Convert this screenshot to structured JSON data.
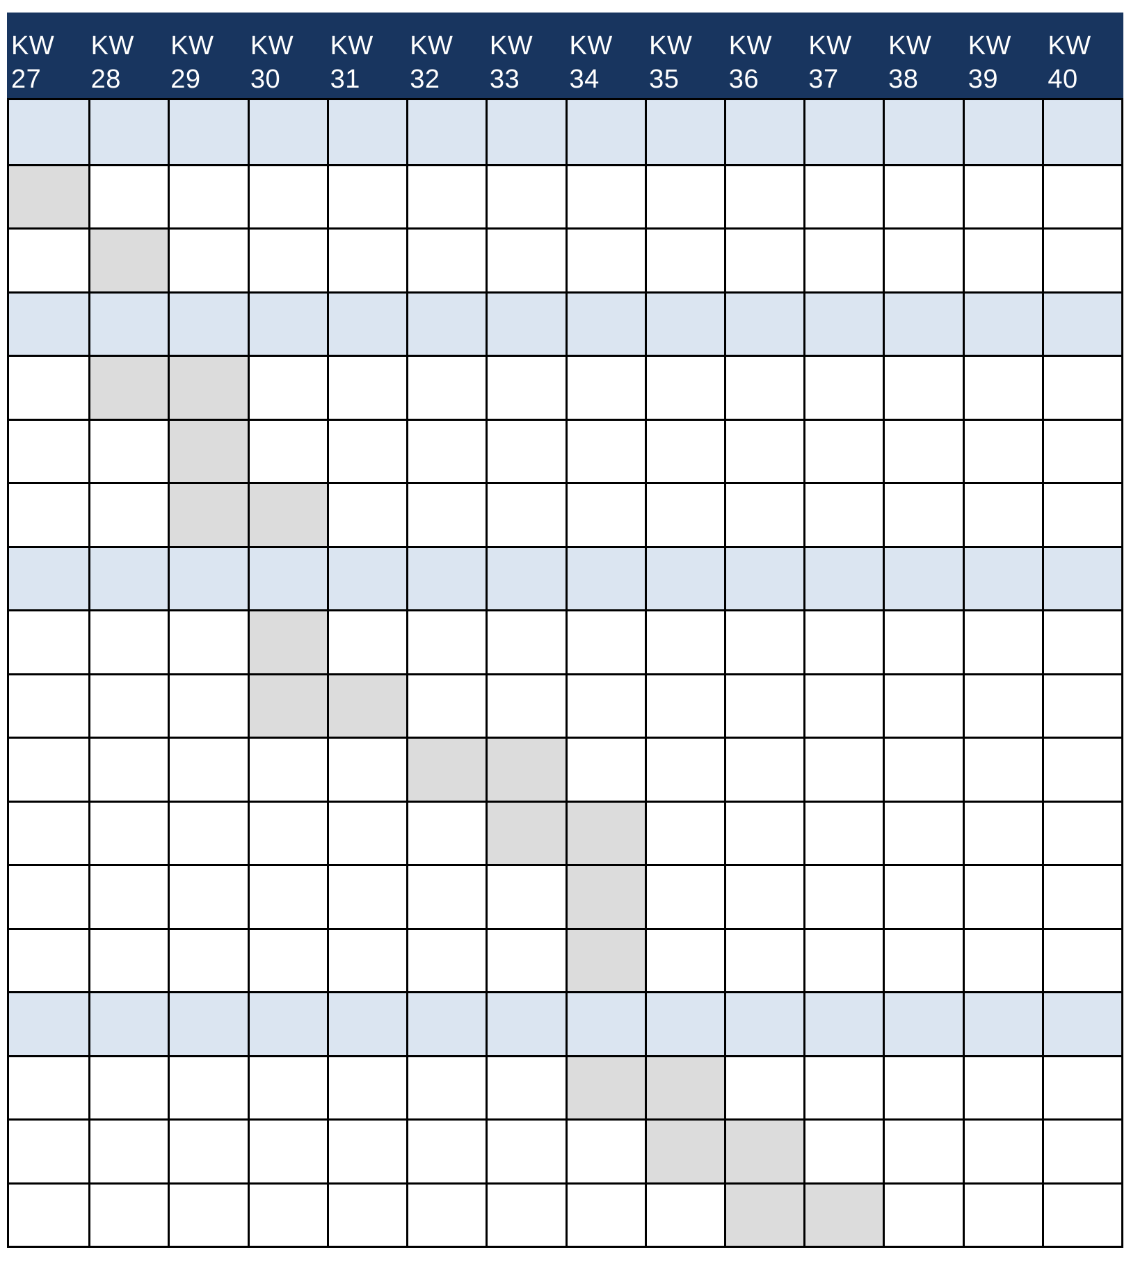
{
  "weeks": [
    {
      "kw": "KW",
      "num": "27"
    },
    {
      "kw": "KW",
      "num": "28"
    },
    {
      "kw": "KW",
      "num": "29"
    },
    {
      "kw": "KW",
      "num": "30"
    },
    {
      "kw": "KW",
      "num": "31"
    },
    {
      "kw": "KW",
      "num": "32"
    },
    {
      "kw": "KW",
      "num": "33"
    },
    {
      "kw": "KW",
      "num": "34"
    },
    {
      "kw": "KW",
      "num": "35"
    },
    {
      "kw": "KW",
      "num": "36"
    },
    {
      "kw": "KW",
      "num": "37"
    },
    {
      "kw": "KW",
      "num": "38"
    },
    {
      "kw": "KW",
      "num": "39"
    },
    {
      "kw": "KW",
      "num": "40"
    }
  ],
  "colors": {
    "header_bg": "#18355f",
    "header_text": "#ffffff",
    "group_row_bg": "#dbe5f1",
    "task_fill": "#dcdcdc",
    "grid_lines": "#000000"
  },
  "rows": [
    {
      "type": "group",
      "filled_weeks": []
    },
    {
      "type": "task",
      "filled_weeks": [
        0
      ]
    },
    {
      "type": "task",
      "filled_weeks": [
        1
      ]
    },
    {
      "type": "group",
      "filled_weeks": []
    },
    {
      "type": "task",
      "filled_weeks": [
        1,
        2
      ]
    },
    {
      "type": "task",
      "filled_weeks": [
        2
      ]
    },
    {
      "type": "task",
      "filled_weeks": [
        2,
        3
      ]
    },
    {
      "type": "group",
      "filled_weeks": []
    },
    {
      "type": "task",
      "filled_weeks": [
        3
      ]
    },
    {
      "type": "task",
      "filled_weeks": [
        3,
        4
      ]
    },
    {
      "type": "task",
      "filled_weeks": [
        5,
        6
      ]
    },
    {
      "type": "task",
      "filled_weeks": [
        6,
        7
      ]
    },
    {
      "type": "task",
      "filled_weeks": [
        7
      ]
    },
    {
      "type": "task",
      "filled_weeks": [
        7
      ]
    },
    {
      "type": "group",
      "filled_weeks": []
    },
    {
      "type": "task",
      "filled_weeks": [
        7,
        8
      ]
    },
    {
      "type": "task",
      "filled_weeks": [
        8,
        9
      ]
    },
    {
      "type": "task",
      "filled_weeks": [
        9,
        10
      ]
    }
  ]
}
